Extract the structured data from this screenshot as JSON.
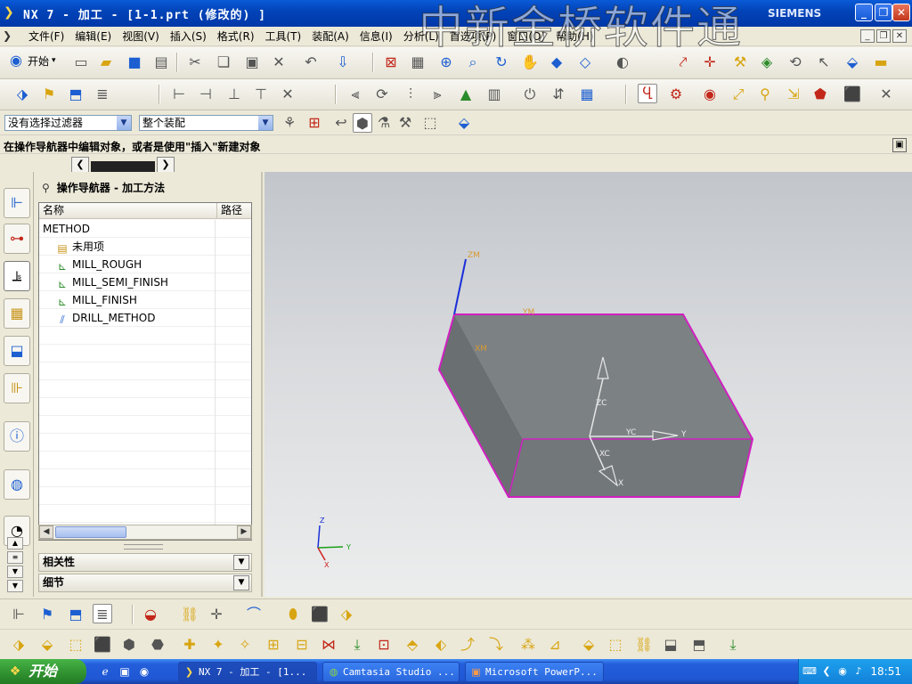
{
  "window": {
    "title": "NX 7 - 加工 - [1-1.prt (修改的) ]",
    "brand": "SIEMENS"
  },
  "watermark": "中新金桥软件通",
  "menu": [
    "文件(F)",
    "编辑(E)",
    "视图(V)",
    "插入(S)",
    "格式(R)",
    "工具(T)",
    "装配(A)",
    "信息(I)",
    "分析(L)",
    "首选项(P)",
    "窗口(O)",
    "帮助(H)"
  ],
  "toolbar": {
    "start_label": "开始"
  },
  "selection_bar": {
    "filter_value": "没有选择过滤器",
    "scope_value": "整个装配"
  },
  "status_line": "在操作导航器中编辑对象，或者是使用\"插入\"新建对象",
  "navigator": {
    "title": "操作导航器 - 加工方法",
    "columns": [
      "名称",
      "路径"
    ],
    "rows": [
      {
        "label": "METHOD",
        "icon": "none"
      },
      {
        "label": "未用项",
        "icon": "folder-icon"
      },
      {
        "label": "MILL_ROUGH",
        "icon": "mill-method-icon"
      },
      {
        "label": "MILL_SEMI_FINISH",
        "icon": "mill-method-icon"
      },
      {
        "label": "MILL_FINISH",
        "icon": "mill-method-icon"
      },
      {
        "label": "DRILL_METHOD",
        "icon": "drill-method-icon"
      }
    ],
    "sections": [
      "相关性",
      "细节"
    ]
  },
  "graphics": {
    "model_labels": {
      "zm": "ZM",
      "ym": "YM",
      "xm": "XM"
    },
    "wcs_labels": {
      "zc": "ZC",
      "yc": "YC",
      "y": "Y",
      "xc": "XC",
      "x": "X"
    },
    "triad_labels": {
      "z": "Z",
      "y": "Y",
      "x": "X"
    },
    "colors": {
      "block_face": "#6f7476",
      "edge": "#d020c0",
      "background": "#d6d9dc"
    }
  },
  "taskbar": {
    "start_label": "开始",
    "tasks": [
      "NX 7 - 加工 - [1...",
      "Camtasia Studio ...",
      "Microsoft PowerP..."
    ],
    "clock": "18:51"
  }
}
